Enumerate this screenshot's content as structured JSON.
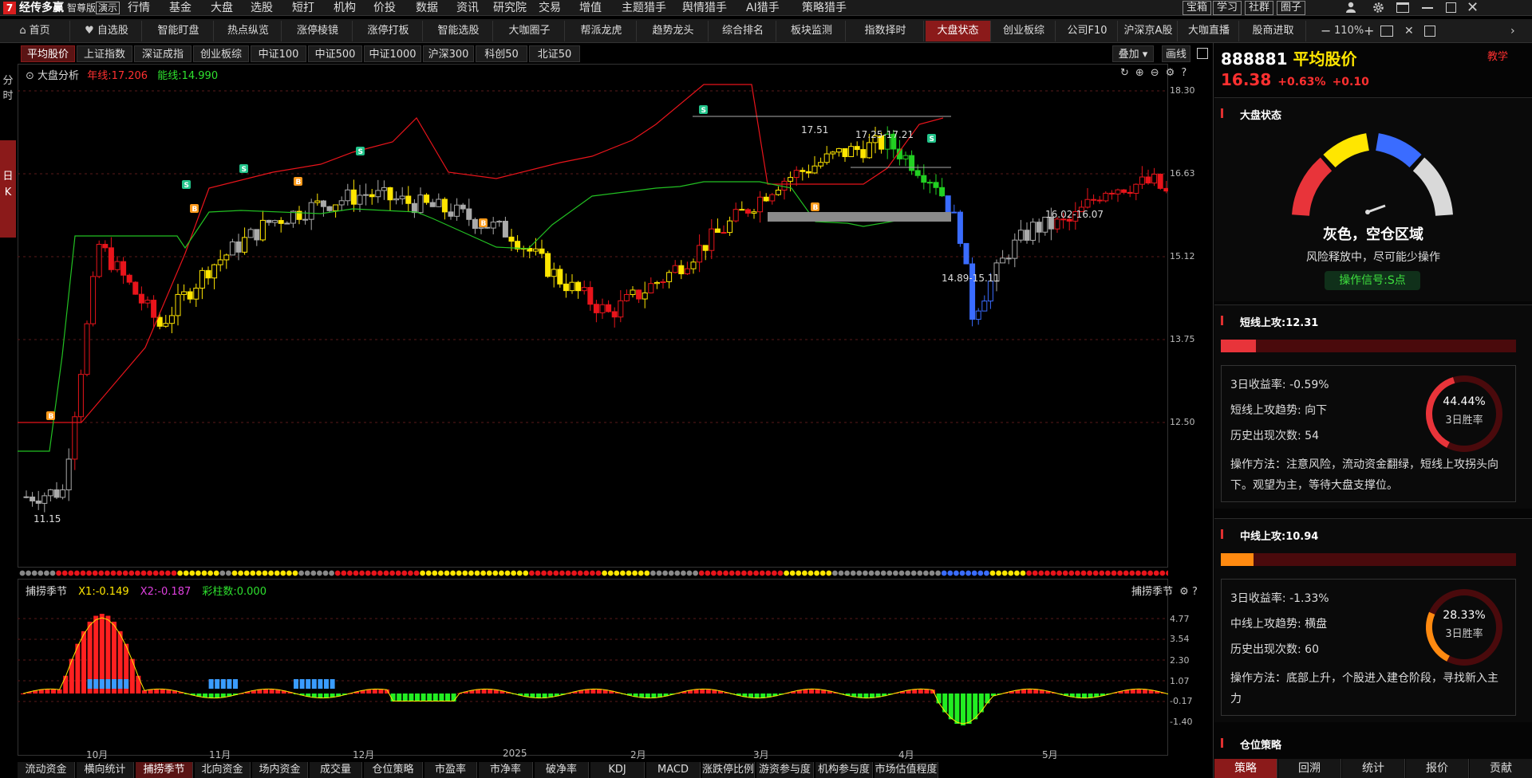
{
  "app": {
    "name": "经传多赢",
    "edition": "智尊版",
    "demo_label": "演示"
  },
  "menu": [
    "行情",
    "基金",
    "大盘",
    "选股",
    "短打",
    "机构",
    "价投",
    "数据",
    "资讯",
    "研究院",
    "交易",
    "增值",
    "主题猎手",
    "舆情猎手",
    "AI猎手",
    "策略猎手"
  ],
  "menu_right": [
    "宝箱",
    "学习",
    "社群",
    "圈子"
  ],
  "tabs": [
    "首页",
    "自选股",
    "智能盯盘",
    "热点纵览",
    "涨停棱镜",
    "涨停打板",
    "智能选股",
    "大咖圈子",
    "帮派龙虎",
    "趋势龙头",
    "综合排名",
    "板块监测",
    "指数择时",
    "大盘状态",
    "创业板综",
    "公司F10",
    "沪深京A股",
    "大咖直播",
    "股商进取"
  ],
  "tabs_active": "大盘状态",
  "zoom": "110%",
  "index_tabs": [
    "平均股价",
    "上证指数",
    "深证成指",
    "创业板综",
    "中证100",
    "中证500",
    "中证1000",
    "沪深300",
    "科创50",
    "北证50"
  ],
  "index_tabs_active": "平均股价",
  "overlay_label": "叠加",
  "draw_label": "画线",
  "left_side": {
    "fenshi": "分时",
    "rik": "日K"
  },
  "main_chart": {
    "title": "大盘分析",
    "nianxian_label": "年线:17.206",
    "nengxian_label": "能线:14.990",
    "y_ticks": [
      "18.30",
      "16.63",
      "15.12",
      "13.75",
      "12.50"
    ],
    "annotations": [
      "17.51",
      "17.25-17.21",
      "16.02-16.07",
      "14.89-15.11",
      "11.15"
    ]
  },
  "indicator": {
    "title": "捕捞季节",
    "x1": "X1:-0.149",
    "x2": "X2:-0.187",
    "caizhu": "彩柱数:0.000",
    "right_label": "捕捞季节",
    "y_ticks": [
      "4.77",
      "3.54",
      "2.30",
      "1.07",
      "-0.17",
      "-1.40"
    ]
  },
  "x_axis": [
    "10月",
    "11月",
    "12月",
    "2025",
    "2月",
    "3月",
    "4月",
    "5月"
  ],
  "bottom_tabs": [
    "流动资金",
    "横向统计",
    "捕捞季节",
    "北向资金",
    "场内资金",
    "成交量",
    "仓位策略",
    "市盈率",
    "市净率",
    "破净率",
    "KDJ",
    "MACD",
    "涨跌停比例",
    "游资参与度",
    "机构参与度",
    "市场估值程度"
  ],
  "bottom_tabs_active": "捕捞季节",
  "right_panel": {
    "code": "888881",
    "name": "平均股价",
    "price": "16.38",
    "change_pct": "+0.63%",
    "change": "+0.10",
    "teach": "教学",
    "market_state_title": "大盘状态",
    "state_text": "灰色，空仓区域",
    "state_desc": "风险释放中，尽可能少操作",
    "signal": "操作信号:S点",
    "short_title": "短线上攻:12.31",
    "short_fill": 0.12,
    "short_stats": [
      "3日收益率: -0.59%",
      "短线上攻趋势: 向下",
      "历史出现次数: 54"
    ],
    "short_method": "操作方法：注意风险，流动资金翻绿，短线上攻拐头向下。观望为主，等待大盘支撑位。",
    "short_gauge_pct": "44.44%",
    "short_gauge_lbl": "3日胜率",
    "short_gauge_val": 0.4444,
    "mid_title": "中线上攻:10.94",
    "mid_fill": 0.11,
    "mid_stats": [
      "3日收益率: -1.33%",
      "中线上攻趋势: 横盘",
      "历史出现次数: 60"
    ],
    "mid_method": "操作方法：底部上升，个股进入建仓阶段，寻找新入主力",
    "mid_gauge_pct": "28.33%",
    "mid_gauge_lbl": "3日胜率",
    "mid_gauge_val": 0.2833,
    "position_title": "仓位策略",
    "bottom_tabs": [
      "策略",
      "回溯",
      "统计",
      "报价",
      "贡献"
    ],
    "bottom_active": "策略"
  },
  "colors": {
    "red": "#e8141b",
    "yellow": "#ffe600",
    "green": "#22d022",
    "blue": "#3a6cff",
    "gray": "#888888"
  }
}
